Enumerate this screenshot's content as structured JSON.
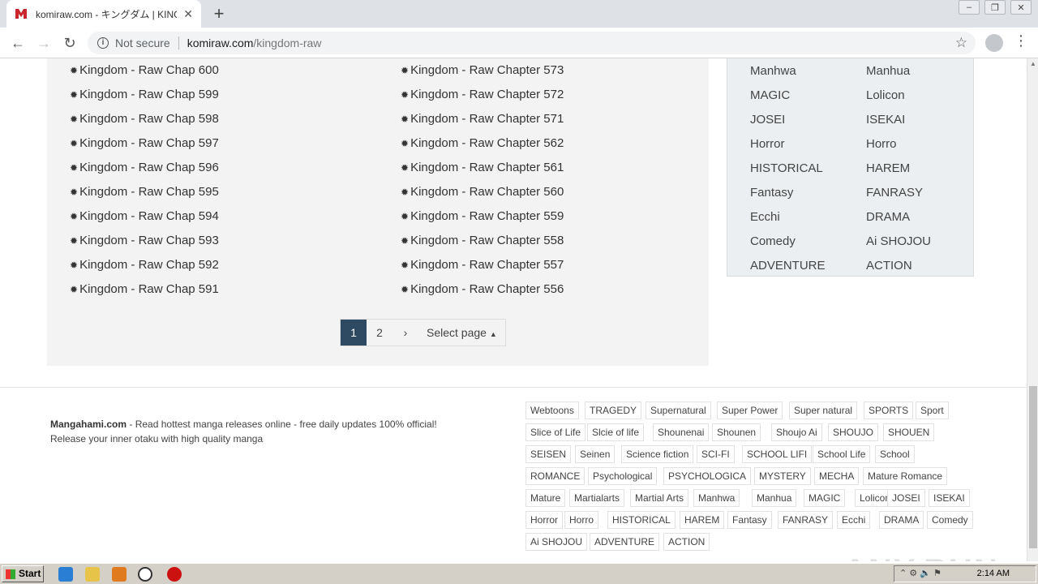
{
  "browser": {
    "tab_title": "komiraw.com - キングダム | KINGDOM",
    "tab_close": "✕",
    "new_tab": "+",
    "not_secure": "Not secure",
    "url_host": "komiraw.com",
    "url_path": "/kingdom-raw"
  },
  "chapters_left": [
    "Kingdom - Raw Chap 600",
    "Kingdom - Raw Chap 599",
    "Kingdom - Raw Chap 598",
    "Kingdom - Raw Chap 597",
    "Kingdom - Raw Chap 596",
    "Kingdom - Raw Chap 595",
    "Kingdom - Raw Chap 594",
    "Kingdom - Raw Chap 593",
    "Kingdom - Raw Chap 592",
    "Kingdom - Raw Chap 591"
  ],
  "chapters_right": [
    "Kingdom - Raw Chapter 573",
    "Kingdom - Raw Chapter 572",
    "Kingdom - Raw Chapter 571",
    "Kingdom - Raw Chapter 562",
    "Kingdom - Raw Chapter 561",
    "Kingdom - Raw Chapter 560",
    "Kingdom - Raw Chapter 559",
    "Kingdom - Raw Chapter 558",
    "Kingdom - Raw Chapter 557",
    "Kingdom - Raw Chapter 556"
  ],
  "pagination": {
    "pages": [
      "1",
      "2"
    ],
    "active": "1",
    "next": "›",
    "select_label": "Select page"
  },
  "genres_left": [
    "Manhwa",
    "MAGIC",
    "JOSEI",
    "Horror",
    "HISTORICAL",
    "Fantasy",
    "Ecchi",
    "Comedy",
    "ADVENTURE"
  ],
  "genres_right": [
    "Manhua",
    "Lolicon",
    "ISEKAI",
    "Horro",
    "HAREM",
    "FANRASY",
    "DRAMA",
    "Ai SHOJOU",
    "ACTION"
  ],
  "footer": {
    "brand": "Mangahami.com",
    "tagline": " - Read hottest manga releases online - free daily updates 100% official!",
    "line2": "Release your inner otaku with high quality manga"
  },
  "tags": [
    [
      "Webtoons",
      "TRAGEDY",
      "Supernatural",
      "Super Power",
      "Super natural",
      "SPORTS",
      "Sport"
    ],
    [
      "Slice of Life",
      "Slcie of life",
      "Shounenai",
      "Shounen",
      "Shoujo Ai",
      "SHOUJO",
      "SHOUEN"
    ],
    [
      "SEISEN",
      "Seinen",
      "Science fiction",
      "SCI-FI",
      "SCHOOL LIFI",
      "School Life",
      "School"
    ],
    [
      "ROMANCE",
      "Psychological",
      "PSYCHOLOGICA",
      "MYSTERY",
      "MECHA",
      "Mature Romance"
    ],
    [
      "Mature",
      "Martialarts",
      "Martial Arts",
      "Manhwa",
      "Manhua",
      "MAGIC",
      "Lolicon",
      "JOSEI",
      "ISEKAI"
    ],
    [
      "Horror",
      "Horro",
      "HISTORICAL",
      "HAREM",
      "Fantasy",
      "FANRASY",
      "Ecchi",
      "DRAMA",
      "Comedy"
    ],
    [
      "Ai SHOJOU",
      "ADVENTURE",
      "ACTION"
    ]
  ],
  "watermark": "ANY.RUN",
  "taskbar": {
    "start": "Start",
    "time": "2:14 AM"
  }
}
